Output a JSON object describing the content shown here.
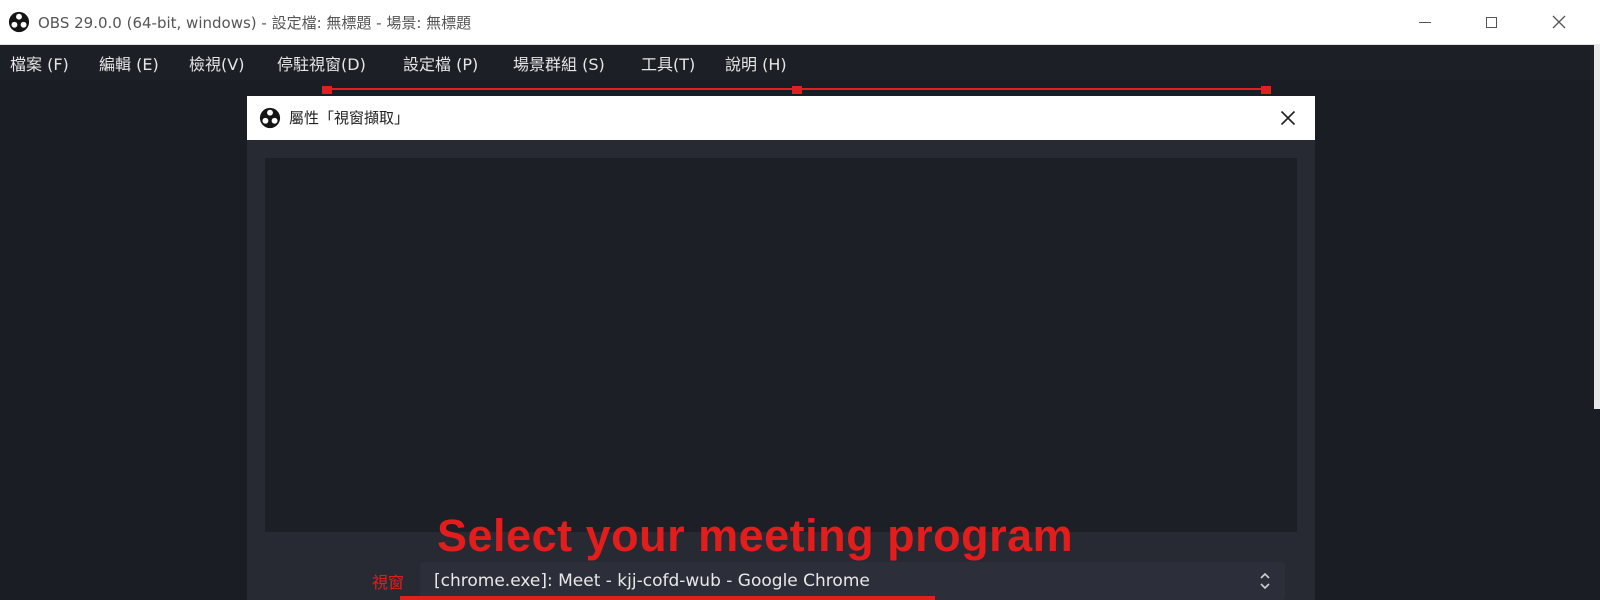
{
  "window": {
    "title": "OBS 29.0.0 (64-bit, windows) - 設定檔: 無標題 - 場景: 無標題",
    "icon": "obs-logo-icon"
  },
  "menu": {
    "items": [
      {
        "label": "檔案 (F)"
      },
      {
        "label": "編輯 (E)"
      },
      {
        "label": "檢視(V)"
      },
      {
        "label": "停駐視窗(D)"
      },
      {
        "label": "設定檔 (P)"
      },
      {
        "label": "場景群組 (S)"
      },
      {
        "label": "工具(T)"
      },
      {
        "label": "說明 (H)"
      }
    ]
  },
  "dialog": {
    "title": "屬性「視窗擷取」",
    "window_label": "視窗",
    "window_value": "[chrome.exe]: Meet - kjj-cofd-wub - Google Chrome"
  },
  "annotation": {
    "text": "Select your meeting program",
    "color": "#e31c1c"
  },
  "colors": {
    "background": "#1d1f26",
    "dialog_body": "#272a33",
    "highlight": "#e0201b"
  }
}
